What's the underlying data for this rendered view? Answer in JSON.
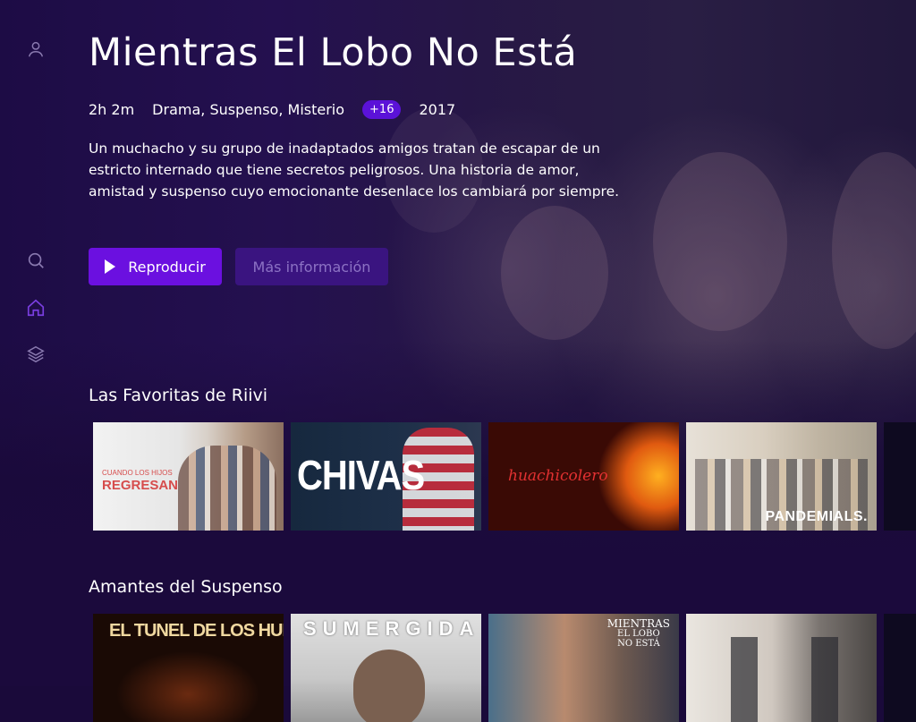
{
  "hero": {
    "title": "Mientras El Lobo No Está",
    "duration": "2h 2m",
    "genres": "Drama, Suspenso, Misterio",
    "rating": "+16",
    "year": "2017",
    "description": "Un muchacho y su grupo de inadaptados amigos tratan de escapar de un estricto internado que tiene secretos peligrosos. Una historia de amor, amistad y suspenso cuyo emocionante desenlace los cambiará por siempre.",
    "play_label": "Reproducir",
    "info_label": "Más información"
  },
  "sidebar": {
    "items": [
      {
        "icon": "user-icon"
      },
      {
        "icon": "search-icon"
      },
      {
        "icon": "home-icon"
      },
      {
        "icon": "layers-icon"
      }
    ]
  },
  "rows": [
    {
      "title": "Las Favoritas de Riivi",
      "tiles": [
        {
          "label_top": "CUANDO LOS HIJOS",
          "label_bottom": "REGRESAN"
        },
        {
          "label": "CHIVAS"
        },
        {
          "label": "huachicolero"
        },
        {
          "label": "PANDEMIALS."
        }
      ]
    },
    {
      "title": "Amantes del Suspenso",
      "tiles": [
        {
          "label": "EL TUNEL DE LOS HUESOS"
        },
        {
          "label": "SUMERGIDA"
        },
        {
          "label_top": "MIENTRAS",
          "label_mid": "EL LOBO",
          "label_bottom": "NO ESTÁ"
        },
        {
          "label": ""
        }
      ]
    }
  ],
  "colors": {
    "accent": "#6b10e0",
    "rating_badge": "#5b12d8",
    "background": "#1a0a3a"
  }
}
